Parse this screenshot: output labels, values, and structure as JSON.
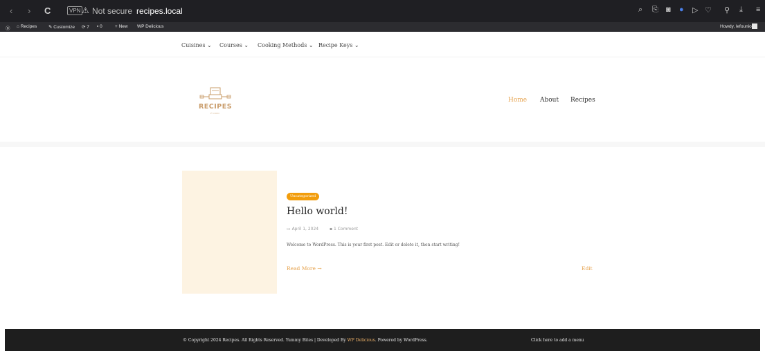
{
  "browser": {
    "back_glyph": "‹",
    "forward_glyph": "›",
    "reload_glyph": "C",
    "vpn_label": "VPN",
    "security_text": "Not secure",
    "url": "recipes.local",
    "toolbar_icons": [
      "search-icon",
      "share-icon",
      "camera-icon",
      "shield-icon",
      "send-icon",
      "heart-icon",
      "profile-icon",
      "download-icon",
      "menu-icon"
    ]
  },
  "admin_bar": {
    "site": "Recipes",
    "customize": "Customize",
    "updates_count": "7",
    "comments_count": "0",
    "new": "New",
    "plugin": "WP Delicious",
    "howdy": "Howdy, lefounio"
  },
  "top_nav": {
    "items": [
      "Cuisines",
      "Courses",
      "Cooking Methods",
      "Recipe Keys"
    ]
  },
  "logo": {
    "text": "RECIPES",
    "sub": "FOOD"
  },
  "main_nav": {
    "home": "Home",
    "about": "About",
    "recipes": "Recipes"
  },
  "post": {
    "category": "Uncategorized",
    "title": "Hello world!",
    "date": "April 1, 2024",
    "comments": "1 Comment",
    "excerpt": "Welcome to WordPress. This is your first post. Edit or delete it, then start writing!",
    "read_more": "Read More →",
    "edit": "Edit"
  },
  "footer": {
    "copyright_prefix": "© Copyright 2024 Recipes. All Rights Reserved. Yummy Bites | Developed By ",
    "developer": "WP Delicious",
    "copyright_suffix": ". Powered by ",
    "wordpress": "WordPress",
    "end": ".",
    "add_menu": "Click here to add a menu"
  },
  "colors": {
    "accent": "#e6a34f",
    "badge": "#f29d0c",
    "thumbnail": "#fdf3e2",
    "footer_bg": "#1e1e1e"
  }
}
